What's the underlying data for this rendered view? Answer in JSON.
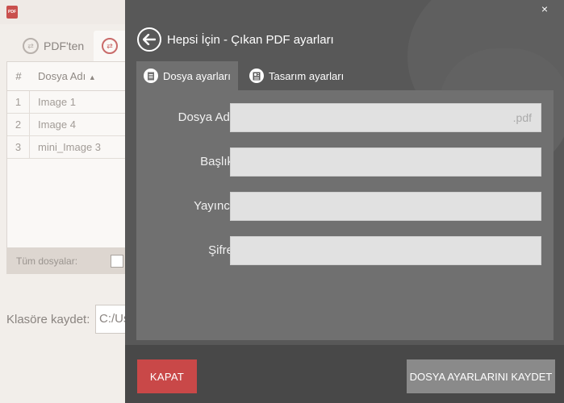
{
  "background": {
    "tabs": [
      {
        "label": "PDF'ten"
      }
    ],
    "table": {
      "headers": {
        "num": "#",
        "name": "Dosya Adı"
      },
      "rows": [
        {
          "num": "1",
          "name": "Image 1"
        },
        {
          "num": "2",
          "name": "Image 4"
        },
        {
          "num": "3",
          "name": "mini_Image 3"
        }
      ]
    },
    "footer_label": "Tüm dosyalar:",
    "save_to_label": "Klasöre kaydet:",
    "save_path": "C:/Us"
  },
  "dialog": {
    "title": "Hepsi İçin - Çıkan PDF ayarları",
    "close_glyph": "×",
    "tabs": [
      {
        "label": "Dosya ayarları",
        "active": true
      },
      {
        "label": "Tasarım ayarları",
        "active": false
      }
    ],
    "fields": {
      "filename": {
        "label": "Dosya Adı",
        "value": "",
        "suffix": ".pdf"
      },
      "title": {
        "label": "Başlık",
        "value": ""
      },
      "publisher": {
        "label": "Yayıncı",
        "value": ""
      },
      "password": {
        "label": "Şifre",
        "value": ""
      }
    },
    "buttons": {
      "close": "KAPAT",
      "save": "DOSYA AYARLARINI KAYDET"
    }
  },
  "colors": {
    "panel": "#585858",
    "content": "#707070",
    "bottom_bar": "#484848",
    "close_button": "#c94848",
    "save_button": "#8a8a8a"
  }
}
